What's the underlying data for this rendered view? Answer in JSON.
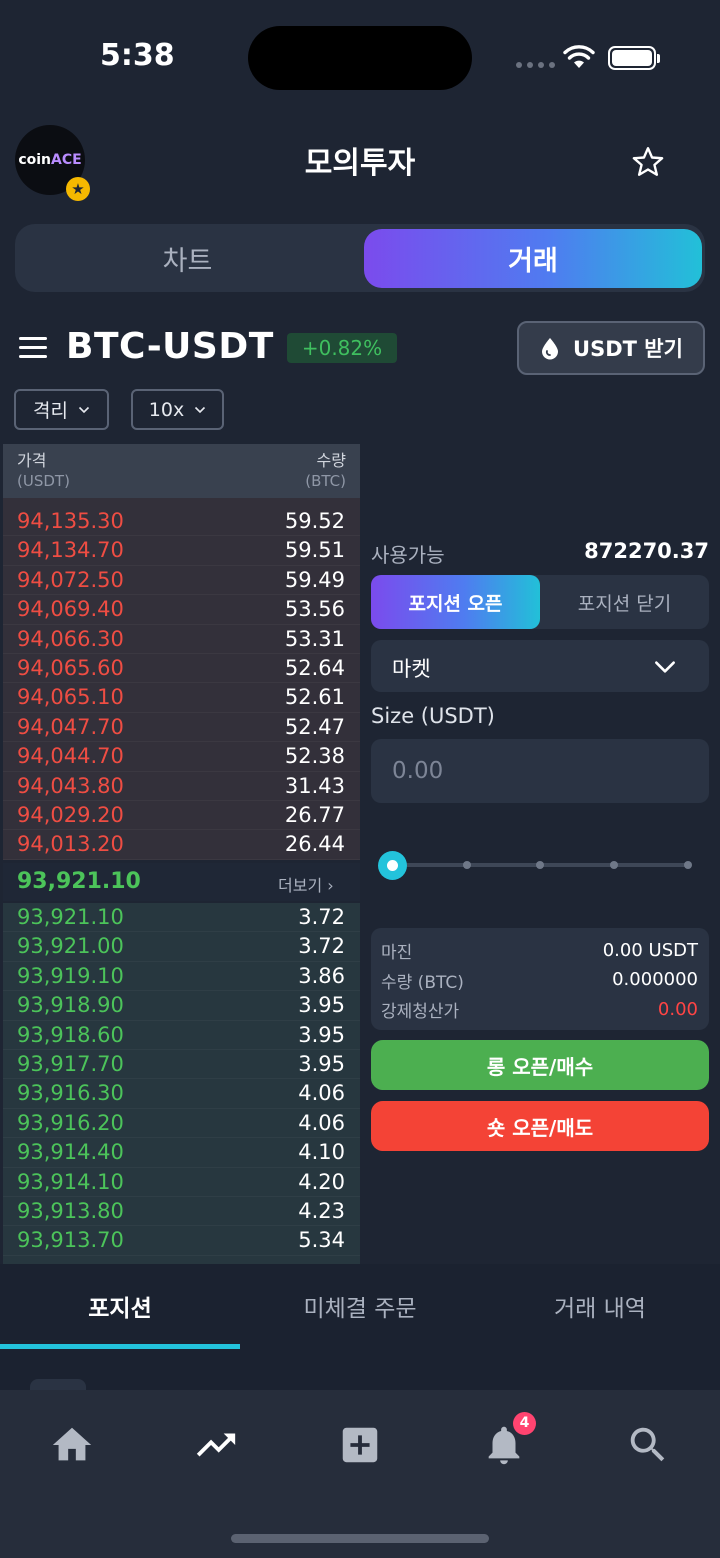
{
  "status_bar": {
    "time": "5:38"
  },
  "header": {
    "logo_text_a": "coin",
    "logo_text_b": "ACE",
    "title": "모의투자"
  },
  "segment": {
    "chart_label": "차트",
    "trade_label": "거래"
  },
  "symbol_row": {
    "symbol": "BTC-USDT",
    "change": "+0.82%",
    "receive_button": "USDT 받기"
  },
  "dropdowns": {
    "margin_mode": "격리",
    "leverage": "10x"
  },
  "orderbook": {
    "price_header": "가격",
    "price_unit": "(USDT)",
    "qty_header": "수량",
    "qty_unit": "(BTC)",
    "asks": [
      {
        "price": "94,135.30",
        "qty": "59.52"
      },
      {
        "price": "94,134.70",
        "qty": "59.51"
      },
      {
        "price": "94,072.50",
        "qty": "59.49"
      },
      {
        "price": "94,069.40",
        "qty": "53.56"
      },
      {
        "price": "94,066.30",
        "qty": "53.31"
      },
      {
        "price": "94,065.60",
        "qty": "52.64"
      },
      {
        "price": "94,065.10",
        "qty": "52.61"
      },
      {
        "price": "94,047.70",
        "qty": "52.47"
      },
      {
        "price": "94,044.70",
        "qty": "52.38"
      },
      {
        "price": "94,043.80",
        "qty": "31.43"
      },
      {
        "price": "94,029.20",
        "qty": "26.77"
      },
      {
        "price": "94,013.20",
        "qty": "26.44"
      }
    ],
    "mid_price": "93,921.10",
    "more_label": "더보기 ›",
    "bids": [
      {
        "price": "93,921.10",
        "qty": "3.72"
      },
      {
        "price": "93,921.00",
        "qty": "3.72"
      },
      {
        "price": "93,919.10",
        "qty": "3.86"
      },
      {
        "price": "93,918.90",
        "qty": "3.95"
      },
      {
        "price": "93,918.60",
        "qty": "3.95"
      },
      {
        "price": "93,917.70",
        "qty": "3.95"
      },
      {
        "price": "93,916.30",
        "qty": "4.06"
      },
      {
        "price": "93,916.20",
        "qty": "4.06"
      },
      {
        "price": "93,914.40",
        "qty": "4.10"
      },
      {
        "price": "93,914.10",
        "qty": "4.20"
      },
      {
        "price": "93,913.80",
        "qty": "4.23"
      },
      {
        "price": "93,913.70",
        "qty": "5.34"
      }
    ]
  },
  "order_form": {
    "available_label": "사용가능",
    "available_value": "872270.37",
    "tab_open": "포지션 오픈",
    "tab_close": "포지션 닫기",
    "order_type": "마켓",
    "size_label": "Size (USDT)",
    "size_placeholder": "0.00",
    "slider_percent": 0,
    "summary": {
      "margin_label": "마진",
      "margin_value": "0.00 USDT",
      "qty_label": "수량 (BTC)",
      "qty_value": "0.000000",
      "liq_label": "강제청산가",
      "liq_value": "0.00"
    },
    "long_button": "롱 오픈/매수",
    "short_button": "숏 오픈/매도"
  },
  "bottom_tabs": [
    "포지션",
    "미체결 주문",
    "거래 내역"
  ],
  "nav": {
    "items": [
      "home-icon",
      "trending-icon",
      "add-box-icon",
      "bell-icon",
      "search-icon"
    ],
    "notification_count": "4"
  },
  "colors": {
    "background": "#1e2533",
    "accent_gradient_start": "#7b4bed",
    "accent_gradient_end": "#22c0d8",
    "ask": "#ef4d43",
    "bid": "#4cc45a",
    "long": "#4caf50",
    "short": "#f44336",
    "liquidation": "#ff4444"
  }
}
